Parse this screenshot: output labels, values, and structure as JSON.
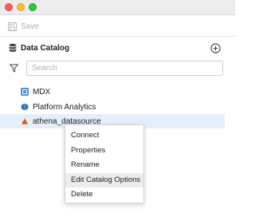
{
  "window": {
    "controls": [
      "close",
      "minimize",
      "maximize"
    ]
  },
  "toolbar": {
    "save_label": "Save",
    "save_icon": "floppy-disk-icon"
  },
  "panel": {
    "title": "Data Catalog",
    "title_icon": "database-icon",
    "add_icon": "plus-circle-icon"
  },
  "filter": {
    "icon": "filter-icon",
    "search_placeholder": "Search",
    "search_value": ""
  },
  "tree": {
    "items": [
      {
        "label": "MDX",
        "icon": "mdx-cube-icon",
        "selected": false
      },
      {
        "label": "Platform Analytics",
        "icon": "platform-analytics-icon",
        "selected": false
      },
      {
        "label": "athena_datasource",
        "icon": "athena-icon",
        "selected": true
      }
    ]
  },
  "context_menu": {
    "items": [
      {
        "label": "Connect",
        "highlighted": false
      },
      {
        "label": "Properties",
        "highlighted": false
      },
      {
        "label": "Rename",
        "highlighted": false
      },
      {
        "label": "Edit Catalog Options",
        "highlighted": true
      },
      {
        "label": "Delete",
        "highlighted": false
      }
    ]
  },
  "colors": {
    "selection": "#e4effb",
    "menu_hover": "#ececec",
    "mdx_icon": "#4a90d9",
    "platform_icon": "#3a6fb0",
    "athena_icon": "#e8762c"
  }
}
